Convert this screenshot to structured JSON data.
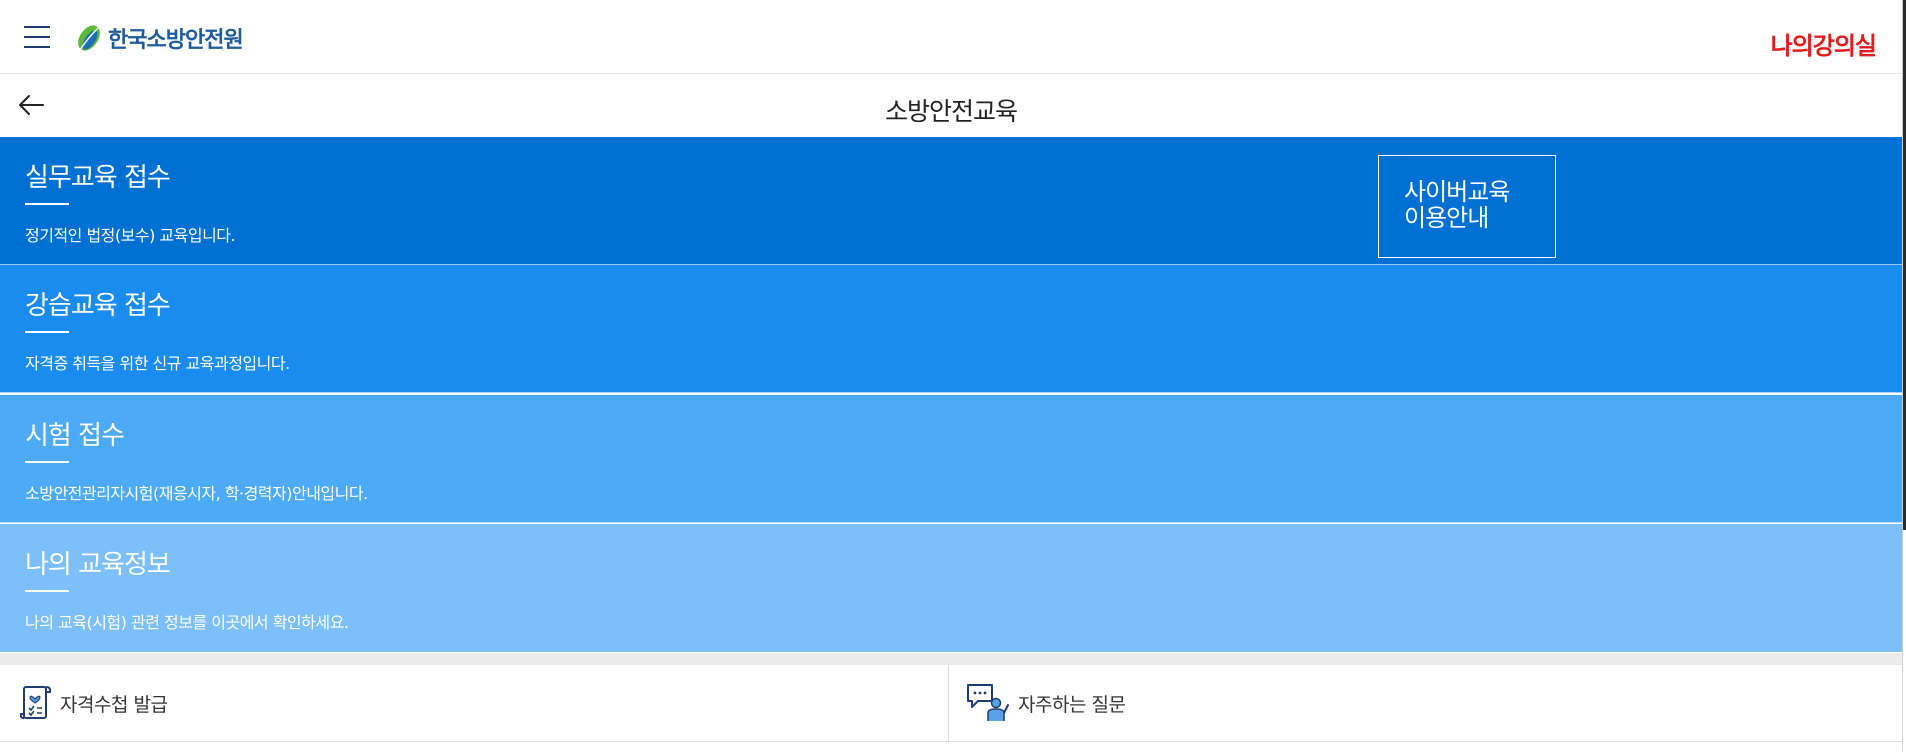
{
  "header": {
    "logo_text": "한국소방안전원",
    "my_classroom": "나의강의실"
  },
  "subheader": {
    "title": "소방안전교육"
  },
  "menu": [
    {
      "title": "실무교육 접수",
      "desc": "정기적인 법정(보수) 교육입니다.",
      "color": "#0070d2"
    },
    {
      "title": "강습교육 접수",
      "desc": "자격증 취득을 위한 신규 교육과정입니다.",
      "color": "#1a8cf0"
    },
    {
      "title": "시험 접수",
      "desc": "소방안전관리자시험(재응시자, 학·경력자)안내입니다.",
      "color": "#4daaf7"
    },
    {
      "title": "나의 교육정보",
      "desc": "나의 교육(시험) 관련 정보를 이곳에서 확인하세요.",
      "color": "#7cbffb"
    }
  ],
  "cyber_button": {
    "line1": "사이버교육",
    "line2": "이용안내"
  },
  "bottom": [
    {
      "label": "자격수첩 발급",
      "icon": "certificate-icon"
    },
    {
      "label": "자주하는 질문",
      "icon": "faq-chat-icon"
    }
  ],
  "colors": {
    "brand": "#1e5b9c",
    "accent_red": "#e21b1b"
  }
}
